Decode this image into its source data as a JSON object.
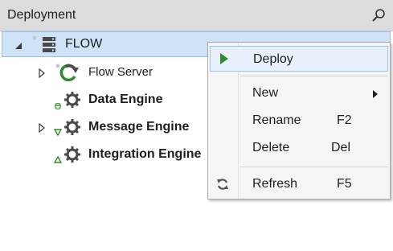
{
  "panel": {
    "title": "Deployment"
  },
  "tree": {
    "root": {
      "label": "FLOW"
    },
    "items": [
      {
        "label": "Flow Server"
      },
      {
        "label": "Data Engine"
      },
      {
        "label": "Message Engine"
      },
      {
        "label": "Integration Engine"
      }
    ]
  },
  "context_menu": {
    "deploy": "Deploy",
    "new": "New",
    "rename": "Rename",
    "rename_shortcut": "F2",
    "delete": "Delete",
    "delete_shortcut": "Del",
    "refresh": "Refresh",
    "refresh_shortcut": "F5"
  },
  "colors": {
    "accent_green": "#2e8b2e",
    "selection": "#cfe3f8",
    "menu_background": "#f5f5f5"
  }
}
